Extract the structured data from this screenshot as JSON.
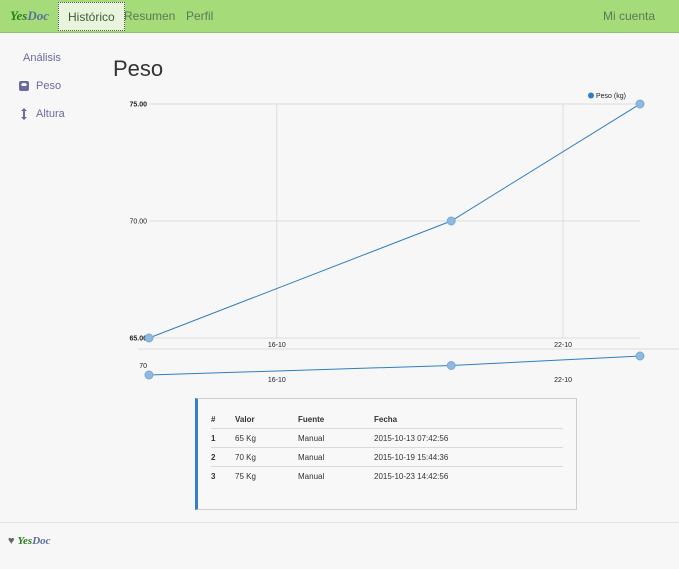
{
  "navbar": {
    "brand_yes": "Yes",
    "brand_doc": "Doc",
    "tabs": [
      {
        "label": "Histórico"
      },
      {
        "label": "Resumen"
      },
      {
        "label": "Perfil"
      }
    ],
    "account": "Mi cuenta",
    "colors": {
      "bar": "#a6db7a"
    }
  },
  "sidebar": {
    "title": "Análisis",
    "items": [
      {
        "label": "Peso",
        "icon": "scale-icon"
      },
      {
        "label": "Altura",
        "icon": "height-arrows-icon"
      }
    ]
  },
  "main": {
    "title": "Peso"
  },
  "chart_data": [
    {
      "type": "line",
      "x": [
        "2015-10-13 07:42:56",
        "2015-10-19 15:44:36",
        "2015-10-23 14:42:56"
      ],
      "series": [
        {
          "name": "Peso (kg)",
          "values": [
            65,
            70,
            75
          ],
          "color": "#2f7ec1"
        }
      ],
      "y_ticks": [
        "65.00",
        "70.00",
        "75.00"
      ],
      "x_ticks": [
        "16-10",
        "22-10"
      ],
      "ylim": [
        65,
        75
      ],
      "grid": true,
      "legend": "top-right"
    },
    {
      "type": "line",
      "x": [
        "2015-10-13 07:42:56",
        "2015-10-19 15:44:36",
        "2015-10-23 14:42:56"
      ],
      "series": [
        {
          "values": [
            65,
            70,
            75
          ],
          "color": "#2f7ec1"
        }
      ],
      "y_ticks": [
        "70"
      ],
      "x_ticks": [
        "16-10",
        "22-10"
      ],
      "ylim": [
        65,
        75
      ],
      "grid": false
    }
  ],
  "table": {
    "headers": [
      "#",
      "Valor",
      "Fuente",
      "Fecha"
    ],
    "rows": [
      [
        "1",
        "65 Kg",
        "Manual",
        "2015-10-13 07:42:56"
      ],
      [
        "2",
        "70 Kg",
        "Manual",
        "2015-10-19 15:44:36"
      ],
      [
        "3",
        "75 Kg",
        "Manual",
        "2015-10-23 14:42:56"
      ]
    ]
  },
  "footer": {
    "brand_yes": "Yes",
    "brand_doc": "Doc"
  }
}
